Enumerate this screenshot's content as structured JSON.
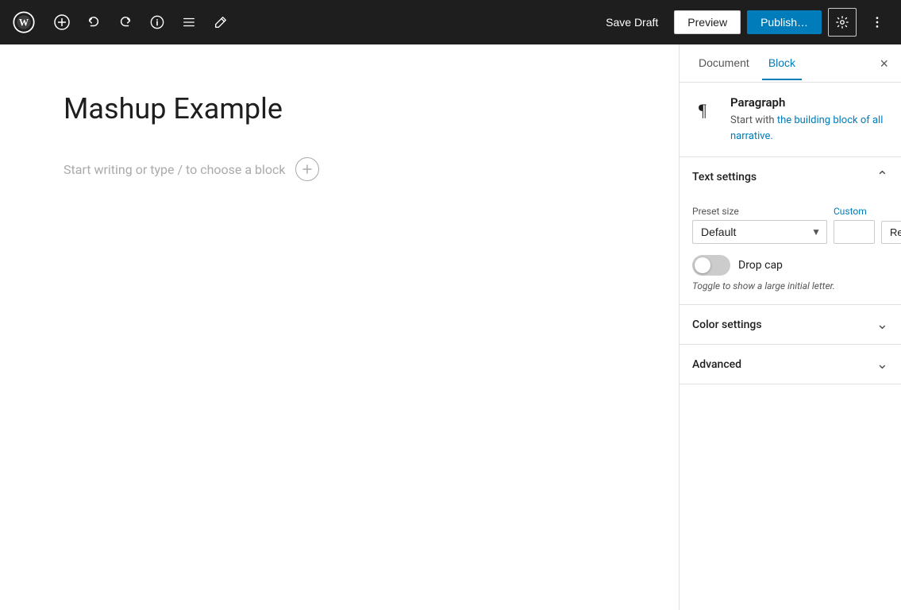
{
  "toolbar": {
    "wp_logo_alt": "WordPress",
    "add_block_label": "+",
    "undo_label": "↩",
    "redo_label": "↪",
    "info_label": "ℹ",
    "block_nav_label": "≡",
    "edit_label": "✏",
    "save_draft_label": "Save Draft",
    "preview_label": "Preview",
    "publish_label": "Publish…",
    "settings_label": "⚙",
    "more_label": "⋮"
  },
  "editor": {
    "post_title": "Mashup Example",
    "placeholder_text": "Start writing or type / to choose a block",
    "placeholder_link": "/ to choose a block"
  },
  "sidebar": {
    "tab_document": "Document",
    "tab_block": "Block",
    "close_label": "×",
    "block_title": "Paragraph",
    "block_description_text": "Start with the building block of all narrative.",
    "block_description_link": "the building block of all narrative.",
    "text_settings_title": "Text settings",
    "preset_size_label": "Preset size",
    "preset_size_value": "Default",
    "custom_label": "Custom",
    "custom_placeholder": "",
    "reset_label": "Reset",
    "drop_cap_label": "Drop cap",
    "drop_cap_hint": "Toggle to show a large initial letter.",
    "color_settings_title": "Color settings",
    "advanced_title": "Advanced"
  }
}
